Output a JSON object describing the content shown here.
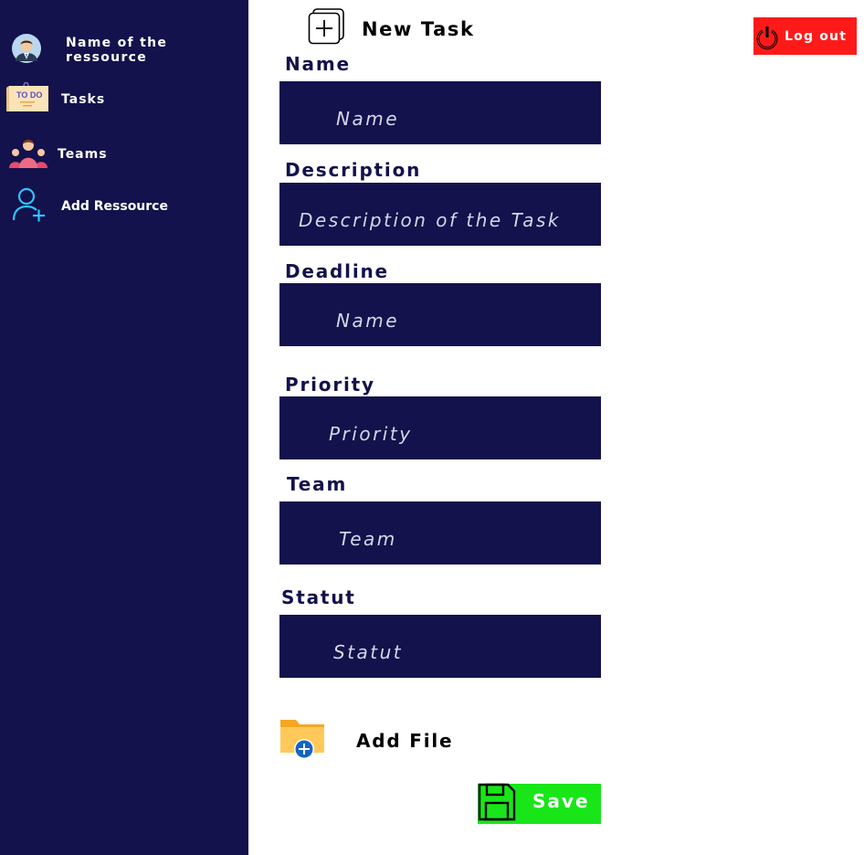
{
  "sidebar": {
    "items": [
      {
        "label": "Name of the ressource",
        "icon": "user-avatar-icon"
      },
      {
        "label": "Tasks",
        "icon": "todo-note-icon"
      },
      {
        "label": "Teams",
        "icon": "team-people-icon"
      },
      {
        "label": "Add Ressource",
        "icon": "add-user-icon"
      }
    ]
  },
  "header": {
    "title": "New Task",
    "title_icon": "plus-square-icon",
    "logout_label": "Log out",
    "logout_icon": "power-icon"
  },
  "form": {
    "fields": [
      {
        "label": "Name",
        "placeholder": "Name"
      },
      {
        "label": "Description",
        "placeholder": "Description of the Task"
      },
      {
        "label": "Deadline",
        "placeholder": "Name"
      },
      {
        "label": "Priority",
        "placeholder": "Priority"
      },
      {
        "label": "Team",
        "placeholder": "Team"
      },
      {
        "label": "Statut",
        "placeholder": "Statut"
      }
    ],
    "add_file_label": "Add File",
    "add_file_icon": "folder-add-icon",
    "save_label": "Save",
    "save_icon": "floppy-disk-icon"
  },
  "colors": {
    "sidebar_bg": "#13124c",
    "input_bg": "#13124c",
    "logout_bg": "#ff1a1a",
    "save_bg": "#19e619"
  }
}
